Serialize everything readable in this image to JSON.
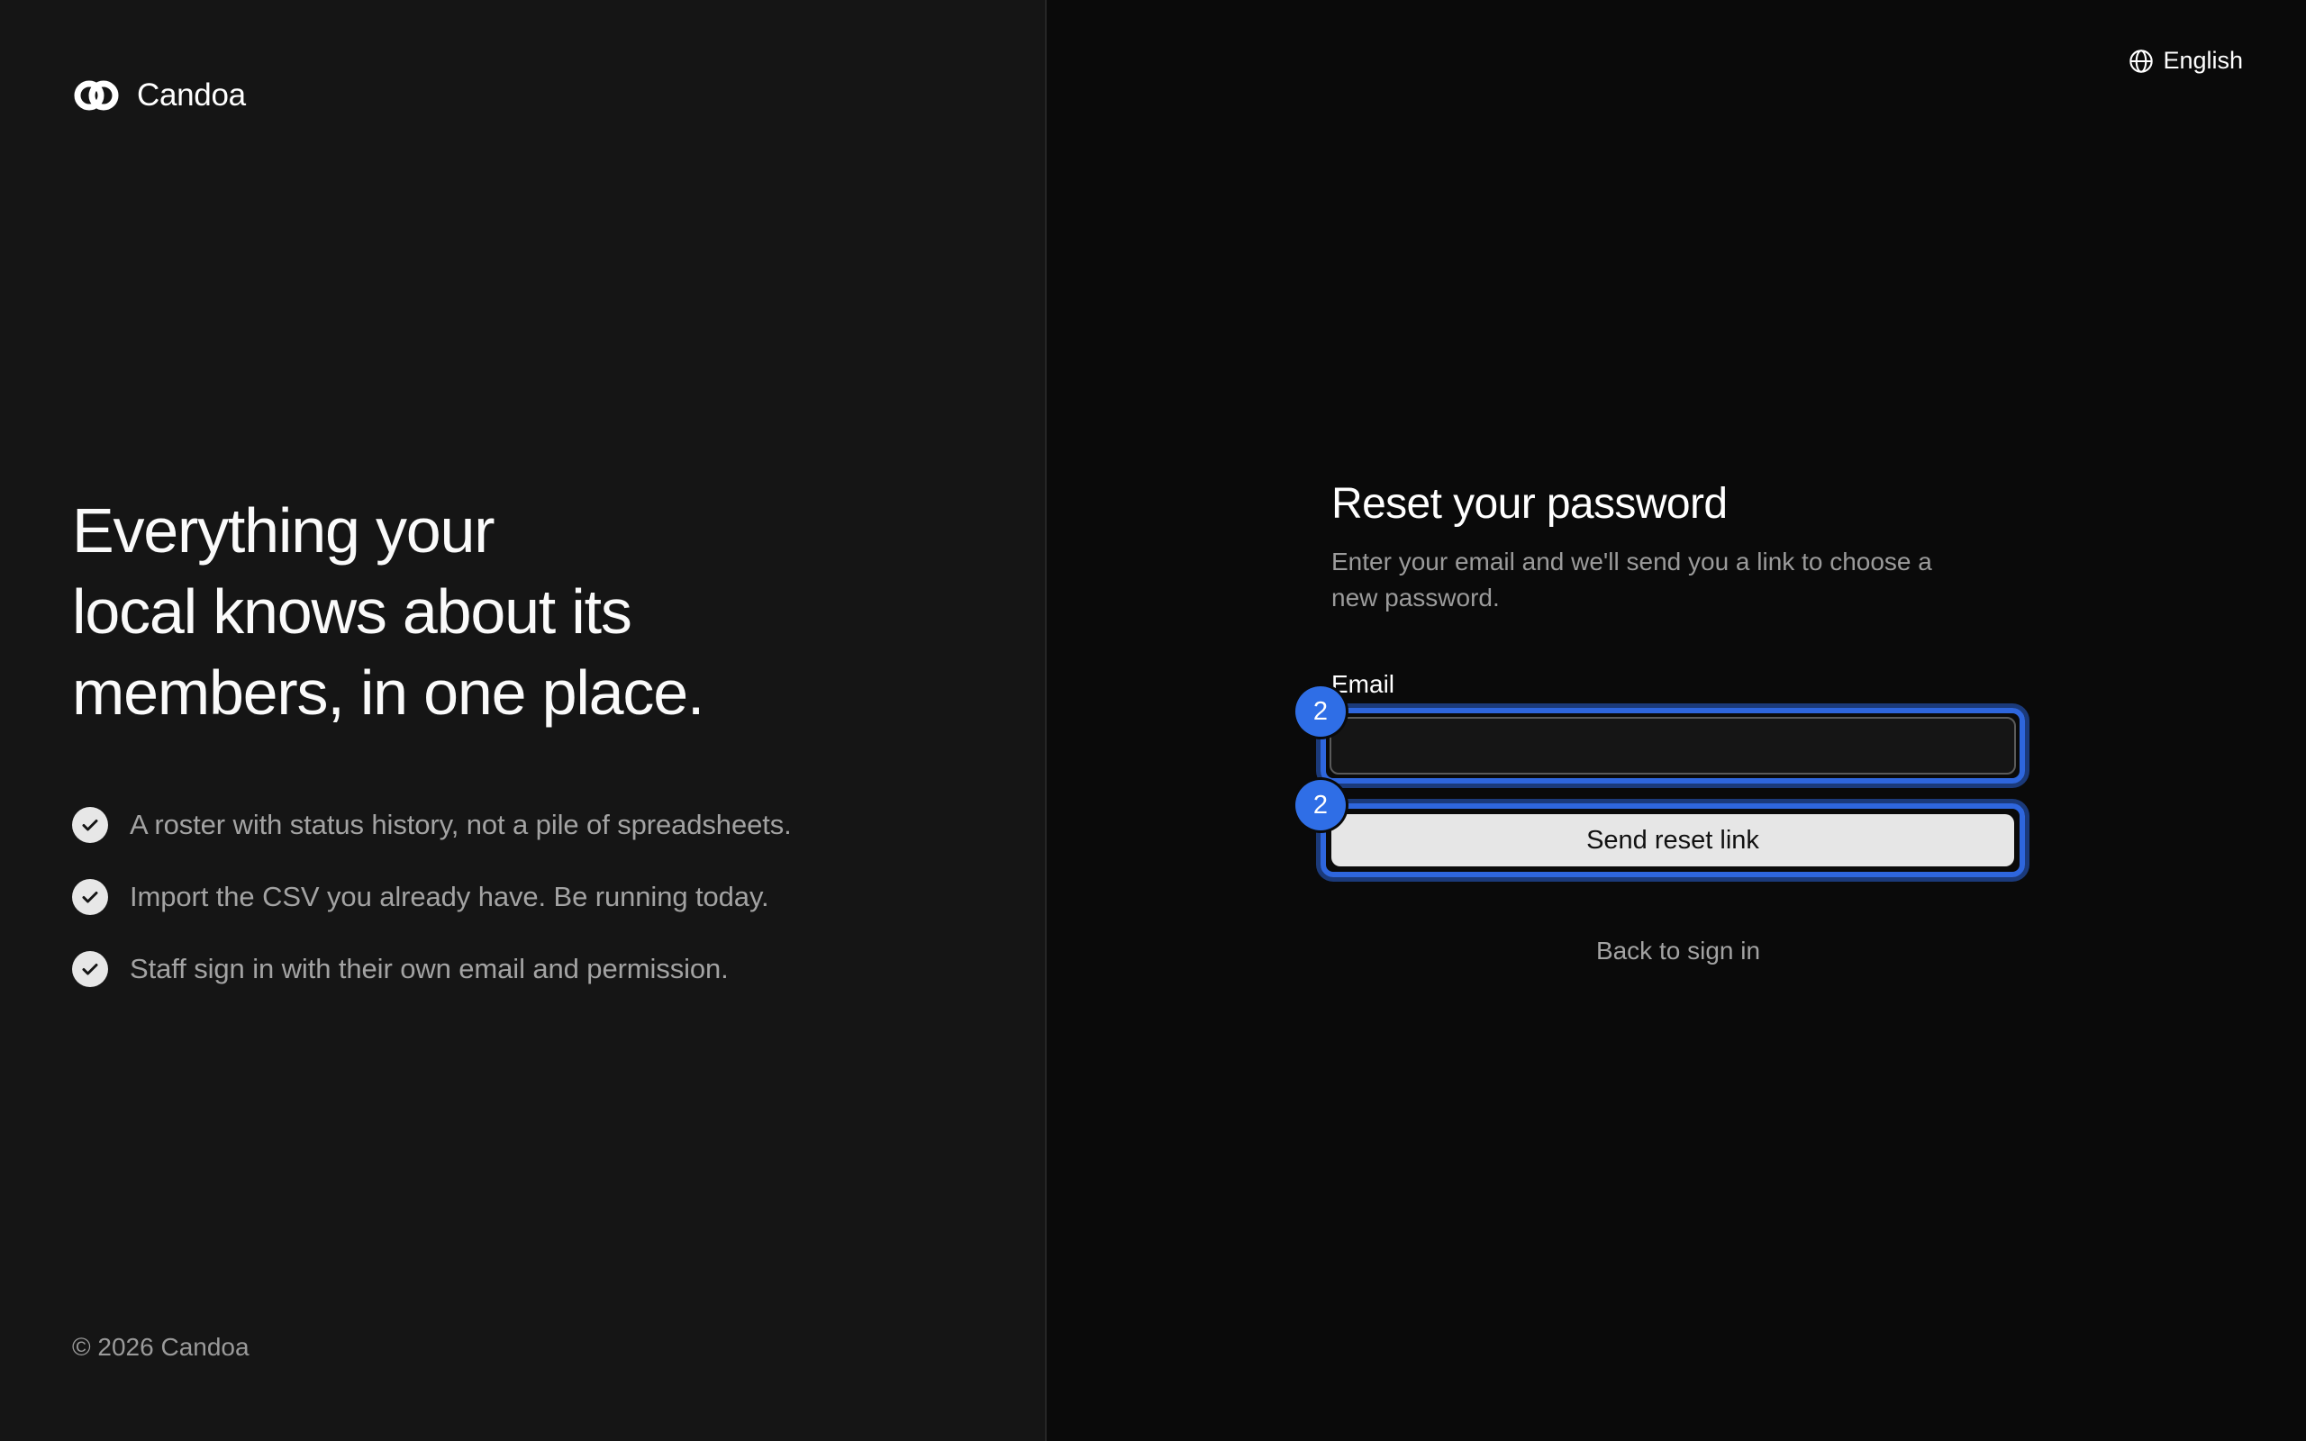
{
  "brand": {
    "name": "Candoa",
    "logo_icon": "interlocked-rings-icon"
  },
  "hero": {
    "headline_lines": [
      "Everything your",
      "local knows about its",
      "members, in one place."
    ],
    "features": [
      {
        "icon": "check-circle-icon",
        "text": "A roster with status history, not a pile of spreadsheets."
      },
      {
        "icon": "check-circle-icon",
        "text": "Import the CSV you already have. Be running today."
      },
      {
        "icon": "check-circle-icon",
        "text": "Staff sign in with their own email and permission."
      }
    ]
  },
  "footer": {
    "copyright": "© 2026 Candoa"
  },
  "language": {
    "icon": "globe-icon",
    "label": "English"
  },
  "form": {
    "title": "Reset your password",
    "subtitle": "Enter your email and we'll send you a link to choose a new password.",
    "email_label": "Email",
    "email_value": "",
    "email_placeholder": "",
    "submit_label": "Send reset link",
    "back_link": "Back to sign in"
  },
  "annotations": {
    "email_badge": "2",
    "submit_badge": "2",
    "highlight_color": "#2e66dd",
    "badge_color": "#2f6ee6"
  },
  "colors": {
    "left_background": "#151515",
    "right_background": "#0a0a0a",
    "button_background": "#e6e6e6"
  }
}
